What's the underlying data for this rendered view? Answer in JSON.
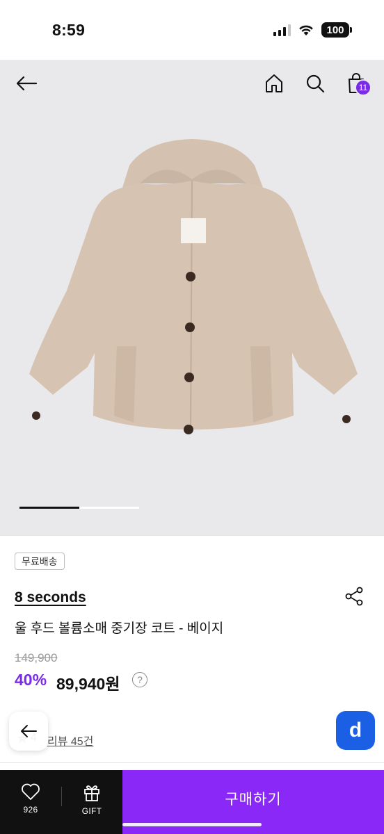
{
  "status": {
    "time": "8:59",
    "battery": "100"
  },
  "nav": {
    "cart_count": "11"
  },
  "product": {
    "badge": "무료배송",
    "brand": "8 seconds",
    "name": "울 후드 볼륨소매 중기장 코트 - 베이지",
    "original_price": "149,900",
    "discount": "40%",
    "price": "89,940원",
    "help": "?",
    "rating": "4",
    "reviews": "리뷰 45건",
    "gallery_progress": 0.5
  },
  "bottom": {
    "like_count": "926",
    "gift_label": "GIFT",
    "buy_label": "구매하기"
  },
  "float": {
    "app_letter": "d"
  },
  "colors": {
    "accent": "#8a28f8",
    "badge": "#7a2be8",
    "app": "#1b5fe5"
  }
}
